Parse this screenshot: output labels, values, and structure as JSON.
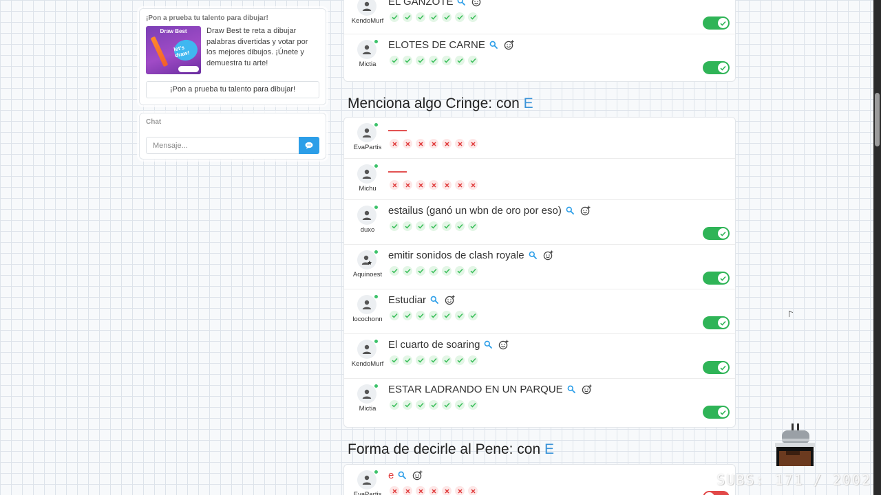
{
  "promo": {
    "title": "¡Pon a prueba tu talento para dibujar!",
    "image_label": "Draw Best",
    "image_bubble": "let's draw!",
    "text": "Draw Best te reta a dibujar palabras divertidas y votar por los mejores dibujos. ¡Únete y demuestra tu arte!",
    "button": "¡Pon a prueba tu talento para dibujar!"
  },
  "chat": {
    "title": "Chat",
    "placeholder": "Mensaje...",
    "send_icon": "chat-bubble-icon"
  },
  "colors": {
    "accent": "#2c9ee8",
    "online": "#3cc26a",
    "toggle_on": "#2fb457",
    "toggle_off": "#e24848",
    "vote_ok": "#3cbf5b",
    "vote_no": "#e03b3b",
    "letter": "#3a93d8"
  },
  "groups": [
    {
      "heading": "",
      "letter": "",
      "rows": [
        {
          "user": "KendoMurf",
          "answer": "EL GANZOTE",
          "valid": true,
          "votes": 7
        },
        {
          "user": "Mictia",
          "answer": "ELOTES DE CARNE",
          "valid": true,
          "votes": 7
        }
      ]
    },
    {
      "heading": "Menciona algo Cringe: con",
      "letter": "E",
      "rows": [
        {
          "user": "EvaPartis",
          "answer": "",
          "valid": false,
          "votes": 7
        },
        {
          "user": "Michu",
          "answer": "",
          "valid": false,
          "votes": 7
        },
        {
          "user": "duxo",
          "answer": "estailus (ganó un wbn de oro por eso)",
          "valid": true,
          "votes": 7
        },
        {
          "user": "Aquinoest",
          "answer": "emitir sonidos de clash royale",
          "valid": true,
          "votes": 7
        },
        {
          "user": "locochonn",
          "answer": "Estudiar",
          "valid": true,
          "votes": 7
        },
        {
          "user": "KendoMurf",
          "answer": "El cuarto de soaring",
          "valid": true,
          "votes": 7
        },
        {
          "user": "Mictia",
          "answer": "ESTAR LADRANDO EN UN PARQUE",
          "valid": true,
          "votes": 7
        }
      ]
    },
    {
      "heading": "Forma de decirle al Pene: con",
      "letter": "E",
      "rows": [
        {
          "user": "EvaPartis",
          "answer": "e",
          "valid": false,
          "votes": 7
        }
      ]
    }
  ],
  "overlay": {
    "subs": "SUBS: 171 / 2002"
  }
}
